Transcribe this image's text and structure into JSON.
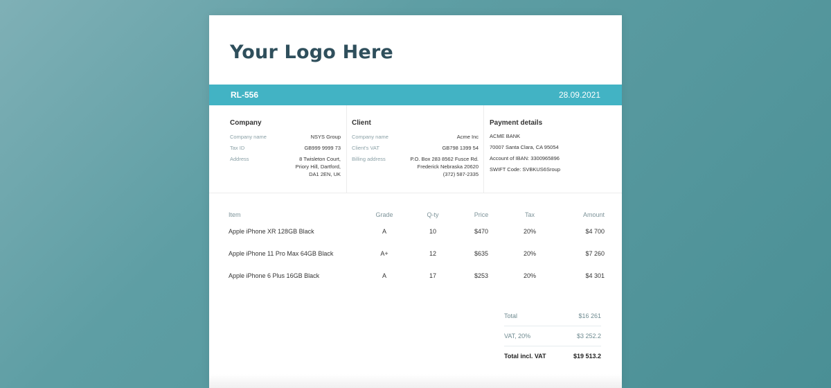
{
  "logo": "Your Logo Here",
  "invoice": {
    "number": "RL-556",
    "date": "28.09.2021"
  },
  "company": {
    "heading": "Company",
    "rows": [
      {
        "k": "Company name",
        "v": "NSYS Group"
      },
      {
        "k": "Tax ID",
        "v": "GB999 9999 73"
      },
      {
        "k": "Address",
        "v": "8 Twisleton Court,\nPriory Hill, Dartford,\nDA1 2EN, UK"
      }
    ]
  },
  "client": {
    "heading": "Client",
    "rows": [
      {
        "k": "Company name",
        "v": "Acme Inc"
      },
      {
        "k": "Client's VAT",
        "v": "GB798 1399 54"
      },
      {
        "k": "Billing address",
        "v": "P.O. Box 283 8562 Fusce Rd.\nFrederick Nebraska 20620\n(372) 587-2335"
      }
    ]
  },
  "payment": {
    "heading": "Payment details",
    "lines": [
      "ACME BANK",
      "70007 Santa Clara, CA 95054",
      "Account of IBAN: 3300965896",
      "SWIFT Code: SVBKUS6Sroup"
    ]
  },
  "table": {
    "headers": {
      "item": "Item",
      "grade": "Grade",
      "qty": "Q-ty",
      "price": "Price",
      "tax": "Tax",
      "amount": "Amount"
    },
    "rows": [
      {
        "item": "Apple iPhone XR 128GB Black",
        "grade": "A",
        "qty": "10",
        "price": "$470",
        "tax": "20%",
        "amount": "$4 700"
      },
      {
        "item": "Apple iPhone 11 Pro Max 64GB Black",
        "grade": "A+",
        "qty": "12",
        "price": "$635",
        "tax": "20%",
        "amount": "$7 260"
      },
      {
        "item": "Apple iPhone 6 Plus 16GB Black",
        "grade": "A",
        "qty": "17",
        "price": "$253",
        "tax": "20%",
        "amount": "$4 301"
      }
    ]
  },
  "totals": [
    {
      "label": "Total",
      "value": "$16 261"
    },
    {
      "label": "VAT, 20%",
      "value": "$3 252.2"
    },
    {
      "label": "Total incl. VAT",
      "value": "$19 513.2"
    }
  ]
}
